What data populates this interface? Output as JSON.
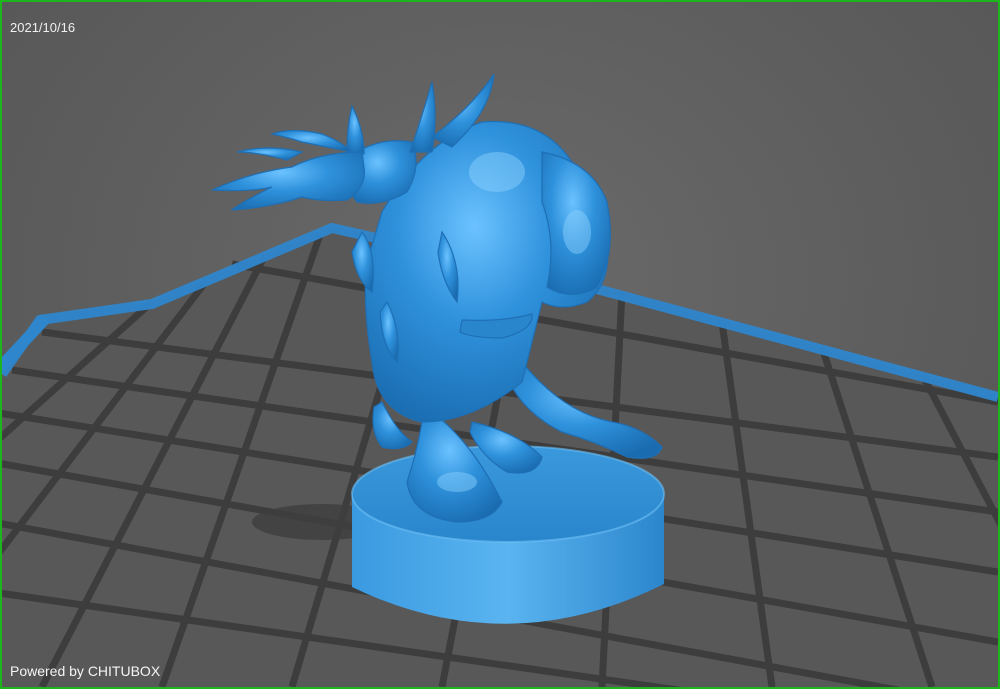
{
  "viewport": {
    "date": "2021/10/16",
    "powered_by": "Powered by CHITUBOX",
    "border_color": "#1db41d",
    "model_color": "#2f8fd6",
    "grid_color": "#3c3c3c",
    "plate_edge_color": "#2e86cc"
  }
}
